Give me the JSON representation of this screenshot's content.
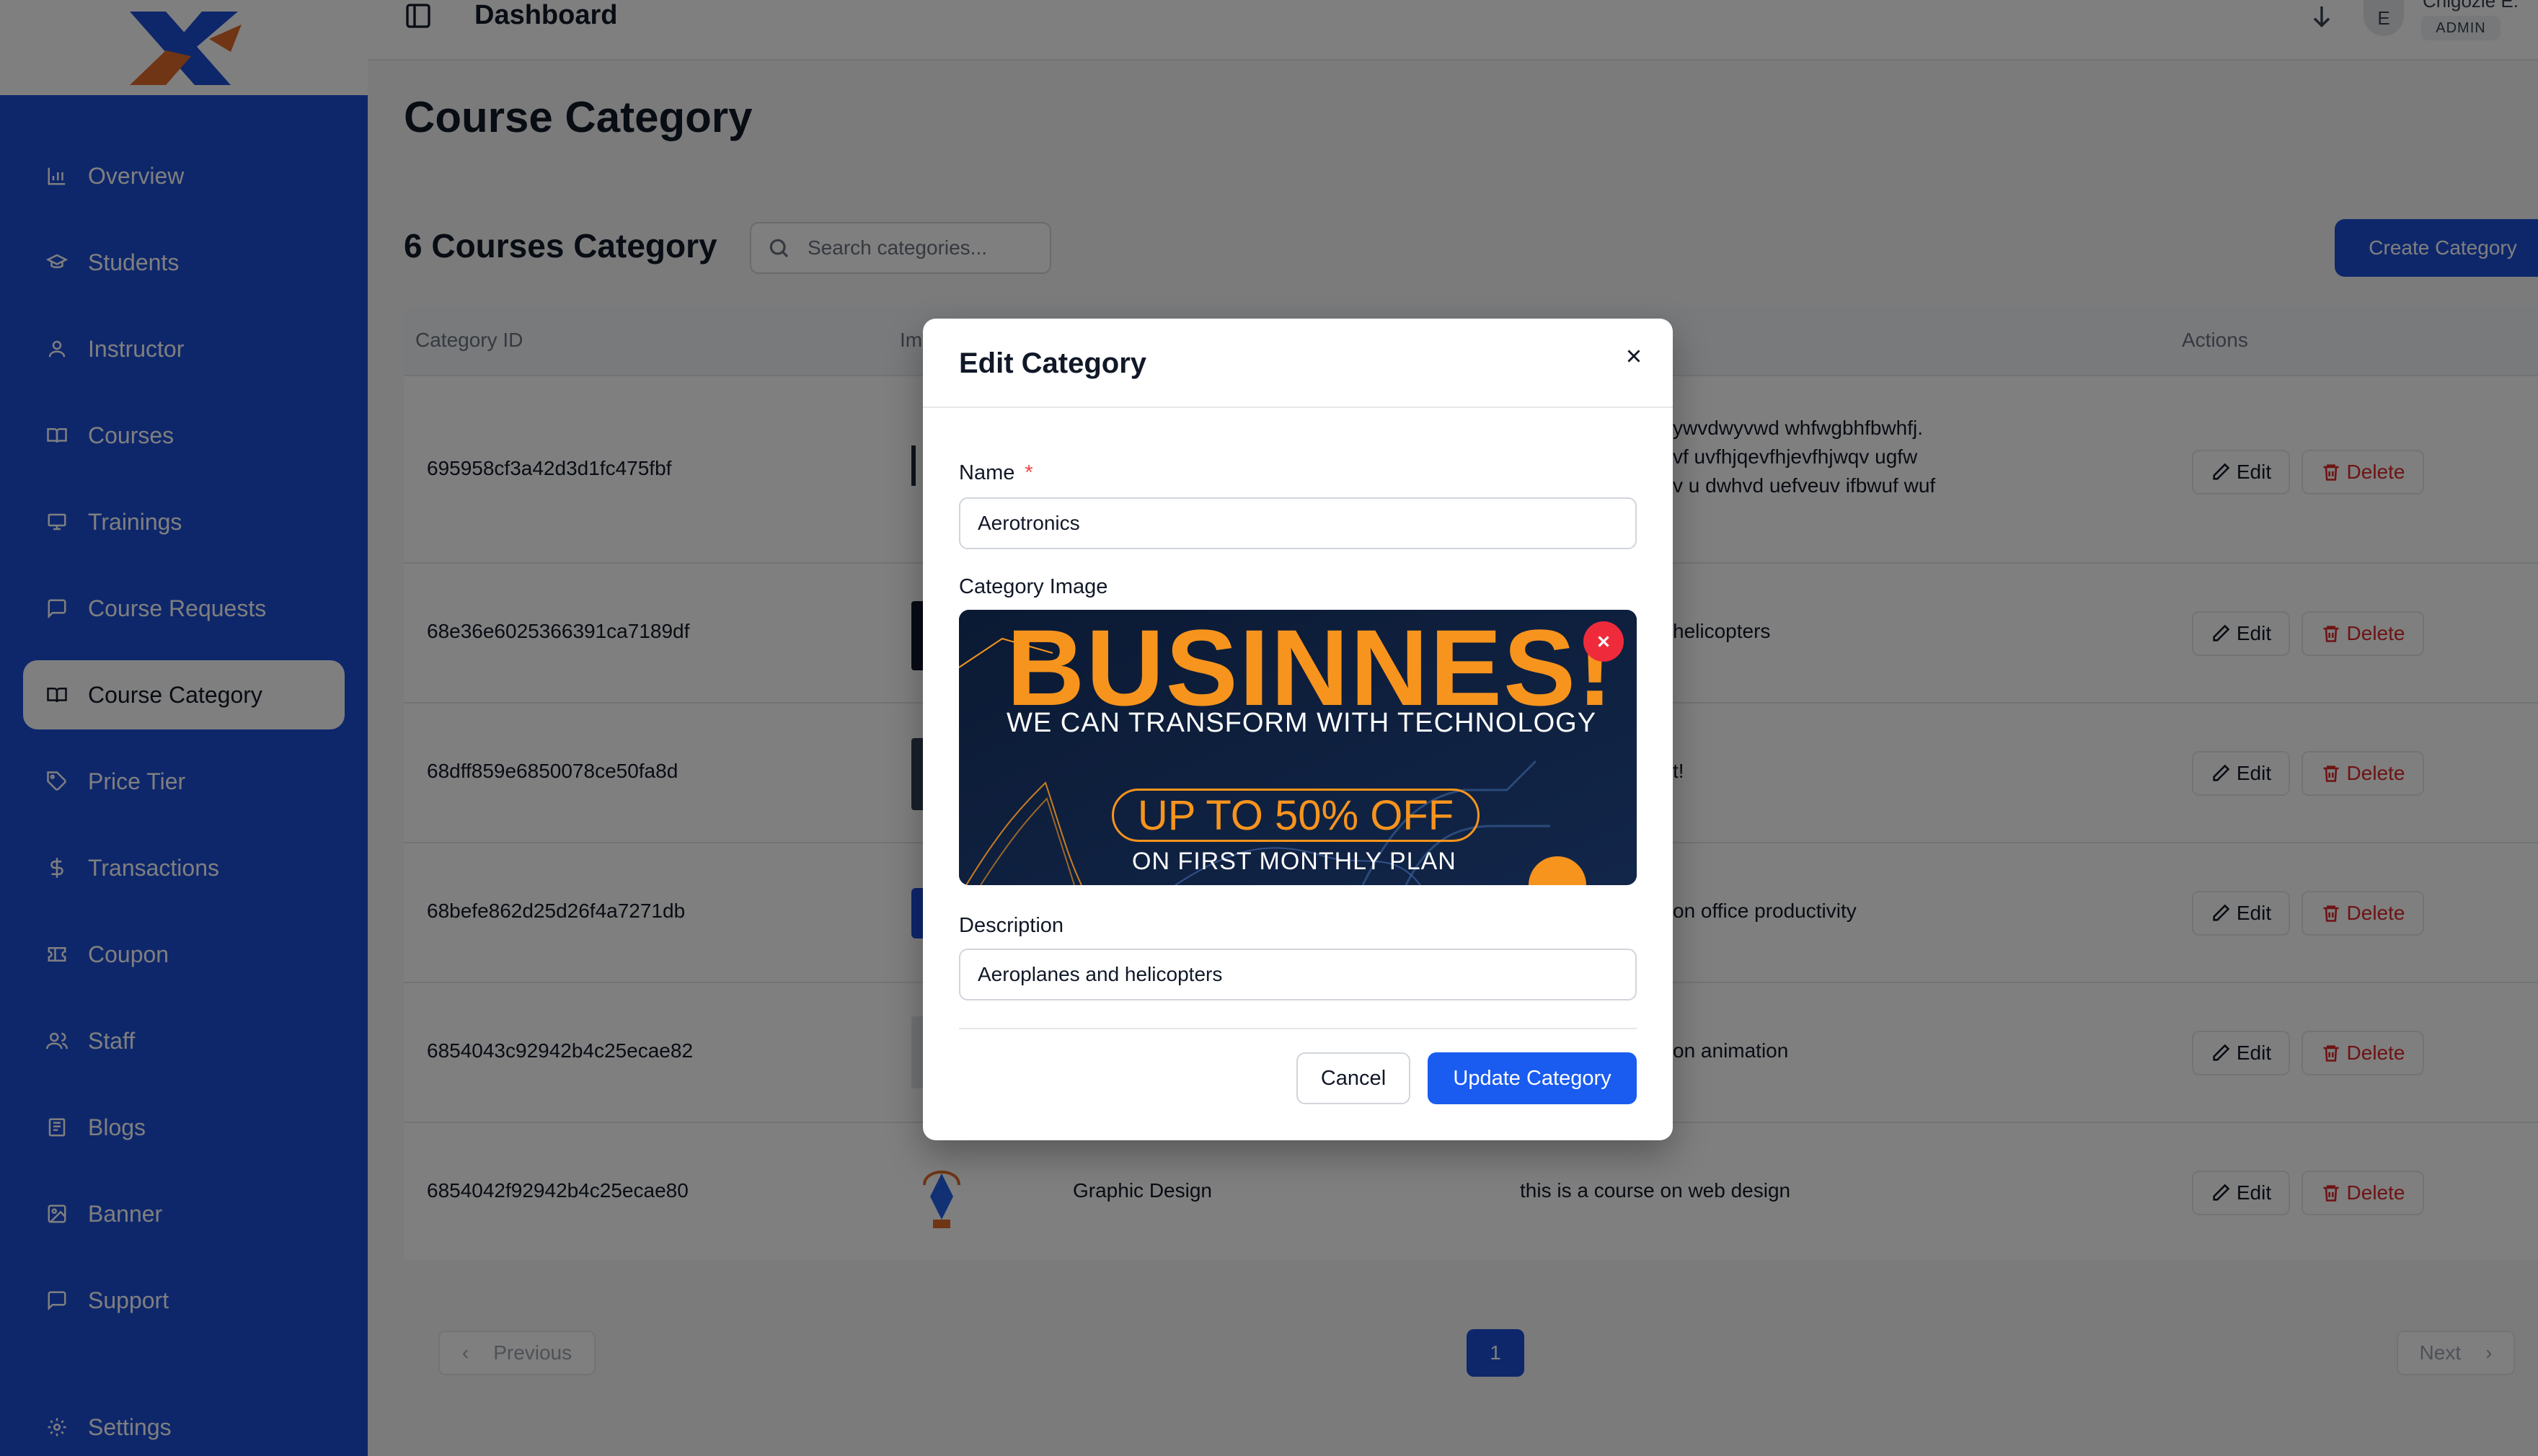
{
  "topbar": {
    "title": "Dashboard",
    "avatar_initial": "E",
    "user_name": "Chigozie E.",
    "user_role": "ADMIN"
  },
  "sidebar": {
    "items": [
      {
        "label": "Overview",
        "icon": "bar-chart-icon"
      },
      {
        "label": "Students",
        "icon": "graduation-cap-icon"
      },
      {
        "label": "Instructor",
        "icon": "user-icon"
      },
      {
        "label": "Courses",
        "icon": "book-open-icon"
      },
      {
        "label": "Trainings",
        "icon": "presentation-icon"
      },
      {
        "label": "Course Requests",
        "icon": "message-square-icon"
      },
      {
        "label": "Course Category",
        "icon": "book-open-icon",
        "active": true
      },
      {
        "label": "Price Tier",
        "icon": "tag-icon"
      },
      {
        "label": "Transactions",
        "icon": "dollar-icon"
      },
      {
        "label": "Coupon",
        "icon": "ticket-icon"
      },
      {
        "label": "Staff",
        "icon": "users-icon"
      },
      {
        "label": "Blogs",
        "icon": "newspaper-icon"
      },
      {
        "label": "Banner",
        "icon": "image-icon"
      },
      {
        "label": "Support",
        "icon": "message-square-icon"
      },
      {
        "label": "Settings",
        "icon": "gear-icon"
      }
    ]
  },
  "main": {
    "page_title": "Course Category",
    "count_title": "6 Courses Category",
    "search_placeholder": "Search categories...",
    "create_label": "Create Category",
    "table": {
      "headers": [
        "Category ID",
        "Im",
        "Actions"
      ],
      "rows": [
        {
          "id": "695958cf3a42d3d1fc475fbf",
          "name": "",
          "description": [
            "ywvdwyvwd whfwgbhfbwhfj.",
            "vf uvfhjqevfhjevfhjwqv ugfw",
            "v u dwhvd uefveuv ifbwuf wuf"
          ]
        },
        {
          "id": "68e36e6025366391ca7189df",
          "name": "",
          "description": [
            "helicopters"
          ]
        },
        {
          "id": "68dff859e6850078ce50fa8d",
          "name": "",
          "description": [
            "t!"
          ]
        },
        {
          "id": "68befe862d25d26f4a7271db",
          "name": "",
          "description": [
            "on office productivity"
          ]
        },
        {
          "id": "6854043c92942b4c25ecae82",
          "name": "",
          "description": [
            "on animation"
          ]
        },
        {
          "id": "6854042f92942b4c25ecae80",
          "name": "Graphic Design",
          "description": [
            "this is a course on web design"
          ]
        }
      ],
      "edit_label": "Edit",
      "delete_label": "Delete"
    },
    "pagination": {
      "previous": "Previous",
      "page": "1",
      "next": "Next"
    }
  },
  "modal": {
    "title": "Edit Category",
    "name_label": "Name",
    "required_mark": "*",
    "name_value": "Aerotronics",
    "image_label": "Category Image",
    "banner": {
      "headline": "BUSINNES!",
      "subline": "WE CAN TRANSFORM WITH TECHNOLOGY",
      "offer": "UP TO 50% OFF",
      "plan": "ON FIRST MONTHLY PLAN"
    },
    "description_label": "Description",
    "description_value": "Aeroplanes and helicopters",
    "cancel_label": "Cancel",
    "update_label": "Update Category"
  },
  "colors": {
    "sidebar": "#1c4fd7",
    "primary_button": "#1a5cf0",
    "danger": "#dc2626",
    "banner_orange": "#f7941d",
    "banner_navy": "#0d1b33"
  }
}
